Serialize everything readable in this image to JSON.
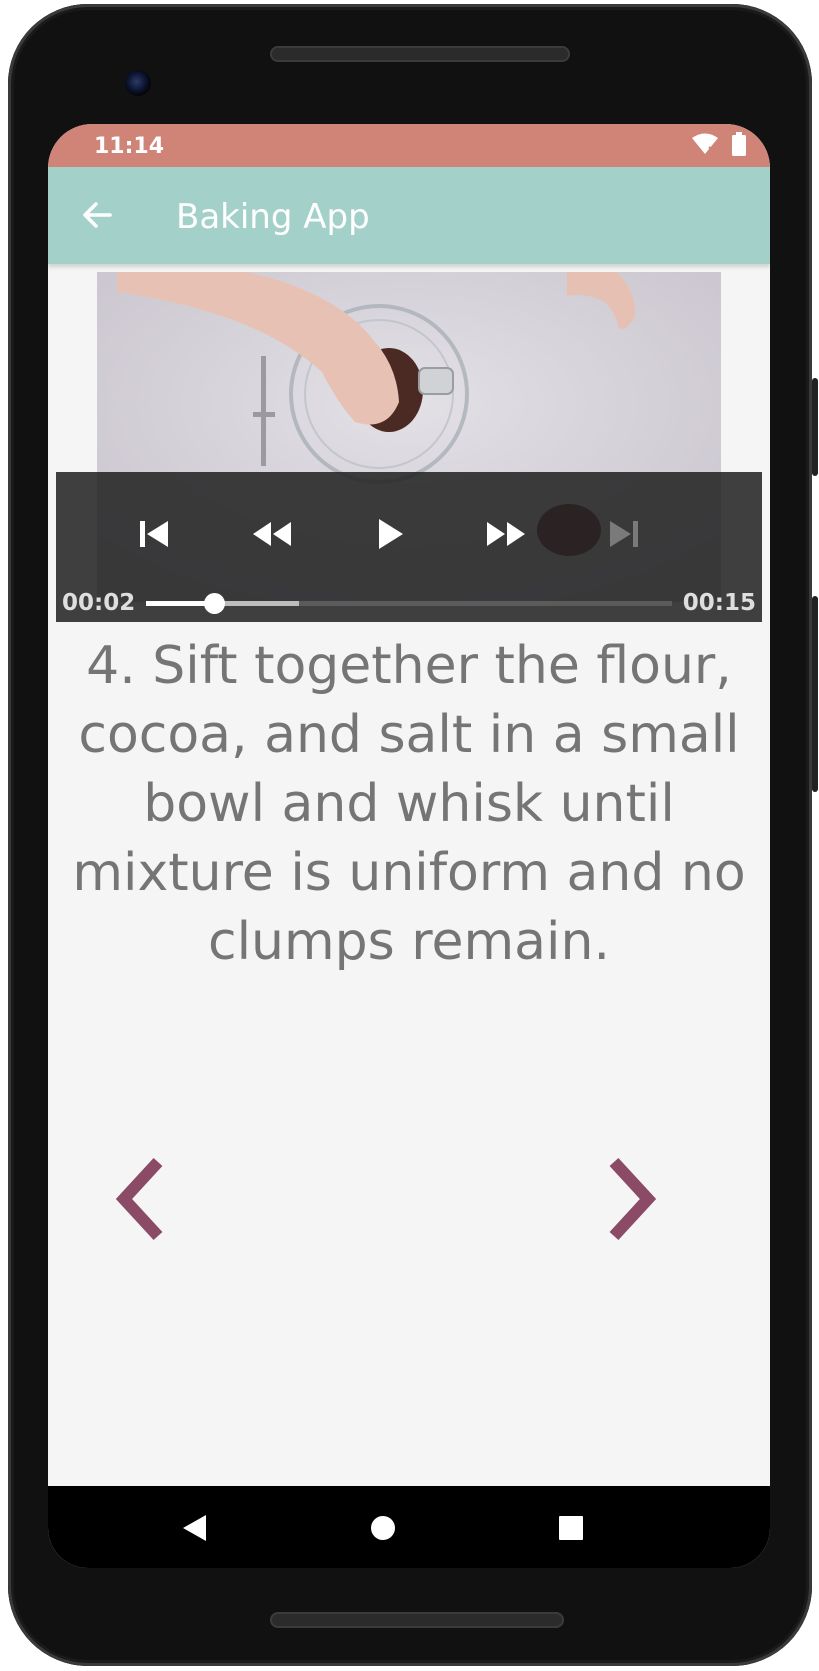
{
  "status_bar": {
    "time": "11:14",
    "color": "#cf8477",
    "icons": [
      "wifi-icon",
      "battery-icon"
    ]
  },
  "app_bar": {
    "title": "Baking App",
    "color": "#a4d0ca",
    "back_icon": "arrow-back-icon"
  },
  "player": {
    "current_time": "00:02",
    "duration": "00:15",
    "played_fraction": 0.13,
    "buffered_fraction": 0.29,
    "buttons": [
      "skip-previous-icon",
      "rewind-icon",
      "play-icon",
      "fast-forward-icon",
      "skip-next-icon"
    ]
  },
  "step": {
    "description": "4. Sift together the flour, cocoa, and salt in a small bowl and whisk until mixture is uniform and no clumps remain."
  },
  "navigation": {
    "arrow_color": "#8b4a65",
    "previous_icon": "chevron-left-icon",
    "next_icon": "chevron-right-icon"
  },
  "system_nav": {
    "buttons": [
      "back-triangle-icon",
      "home-circle-icon",
      "recents-square-icon"
    ]
  }
}
